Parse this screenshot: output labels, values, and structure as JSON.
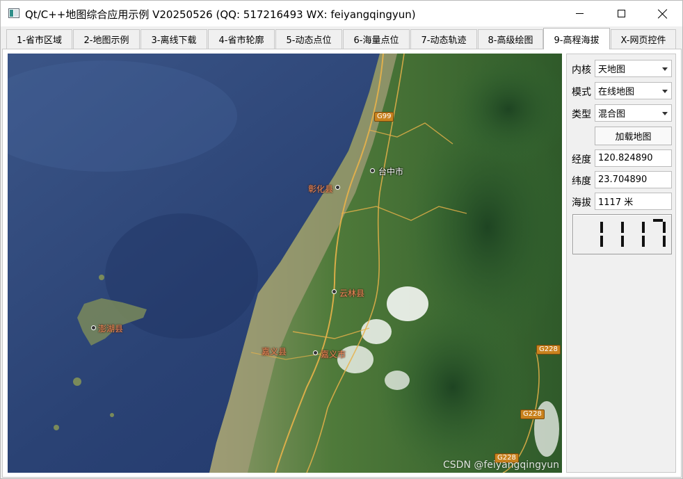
{
  "window": {
    "title": "Qt/C++地图综合应用示例 V20250526 (QQ: 517216493 WX: feiyangqingyun)"
  },
  "tabs": [
    {
      "label": "1-省市区域",
      "active": false
    },
    {
      "label": "2-地图示例",
      "active": false
    },
    {
      "label": "3-离线下载",
      "active": false
    },
    {
      "label": "4-省市轮廓",
      "active": false
    },
    {
      "label": "5-动态点位",
      "active": false
    },
    {
      "label": "6-海量点位",
      "active": false
    },
    {
      "label": "7-动态轨迹",
      "active": false
    },
    {
      "label": "8-高级绘图",
      "active": false
    },
    {
      "label": "9-高程海拔",
      "active": true
    },
    {
      "label": "X-网页控件",
      "active": false
    }
  ],
  "map": {
    "labels": {
      "taichung": "台中市",
      "changhua": "彰化县",
      "yunlin": "云林县",
      "penghu": "澎湖县",
      "chiayi_county": "嘉义县",
      "chiayi_city": "嘉义市"
    },
    "shields": {
      "g99": "G99",
      "g228_a": "G228",
      "g228_b": "G228",
      "g228_c": "G228"
    },
    "watermark": "CSDN @feiyangqingyun"
  },
  "panel": {
    "kernel_label": "内核",
    "kernel_value": "天地图",
    "mode_label": "模式",
    "mode_value": "在线地图",
    "type_label": "类型",
    "type_value": "混合图",
    "load_button": "加载地图",
    "lng_label": "经度",
    "lng_value": "120.824890",
    "lat_label": "纬度",
    "lat_value": "23.704890",
    "alt_label": "海拔",
    "alt_value": "1117 米",
    "lcd_value": "1117"
  }
}
